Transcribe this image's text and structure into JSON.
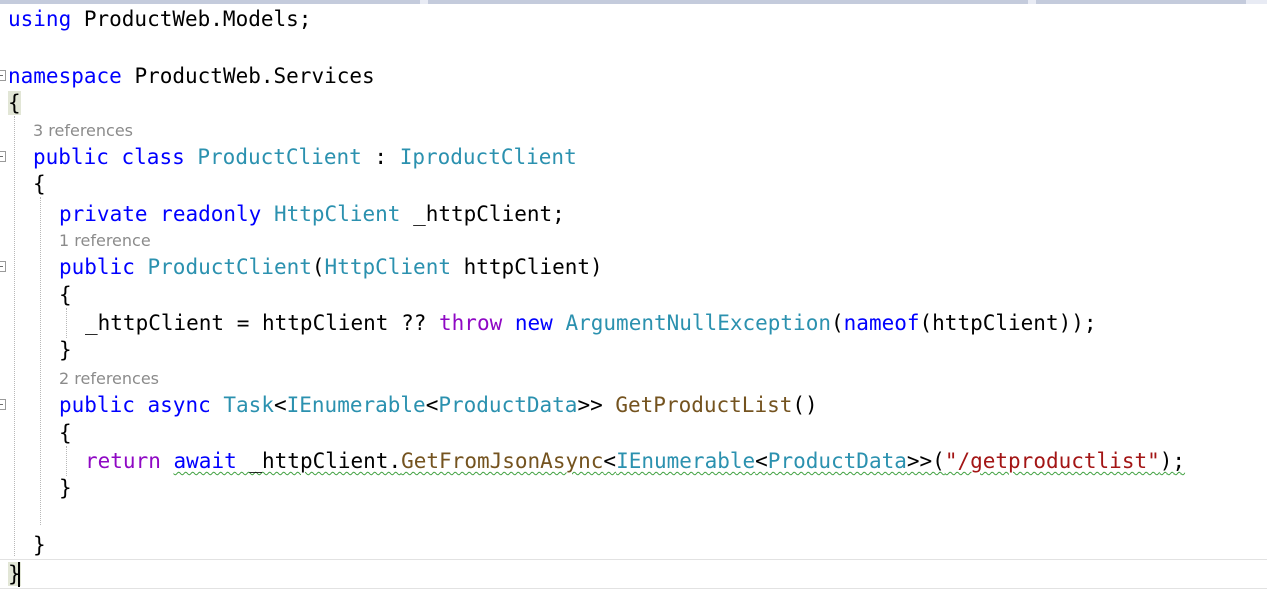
{
  "editor": {
    "lines": {
      "using_kw": "using",
      "using_ns": " ProductWeb.Models;",
      "namespace_kw": "namespace",
      "namespace_name": " ProductWeb.Services",
      "brace_open": "{",
      "lens_class": "3 references",
      "class_public": "public",
      "class_kw": "class",
      "class_name": "ProductClient",
      "class_colon": " : ",
      "class_iface": "IproductClient",
      "class_brace_open": "{",
      "field_private": "private",
      "field_readonly": "readonly",
      "field_type": "HttpClient",
      "field_name": " _httpClient;",
      "lens_ctor": "1 reference",
      "ctor_public": "public",
      "ctor_name": "ProductClient",
      "ctor_paren": "(",
      "ctor_ptype": "HttpClient",
      "ctor_pname": " httpClient)",
      "ctor_brace_open": "{",
      "assign_lhs": "_httpClient = httpClient ?? ",
      "assign_throw": "throw",
      "assign_new": "new",
      "assign_ex": "ArgumentNullException",
      "assign_paren": "(",
      "assign_nameof": "nameof",
      "assign_arg": "(httpClient));",
      "ctor_brace_close": "}",
      "lens_method": "2 references",
      "m_public": "public",
      "m_async": "async",
      "m_task": "Task",
      "m_lt1": "<",
      "m_ienum": "IEnumerable",
      "m_lt2": "<",
      "m_pd": "ProductData",
      "m_gt": ">> ",
      "m_name": "GetProductList",
      "m_parens": "()",
      "m_brace_open": "{",
      "r_return": "return",
      "r_await": "await",
      "r_obj": " _httpClient.",
      "r_method": "GetFromJsonAsync",
      "r_lt1": "<",
      "r_ienum": "IEnumerable",
      "r_lt2": "<",
      "r_pd": "ProductData",
      "r_gt": ">>(",
      "r_str": "\"/getproductlist\"",
      "r_end": ");",
      "m_brace_close": "}",
      "class_brace_close": "}",
      "brace_close": "}"
    }
  }
}
